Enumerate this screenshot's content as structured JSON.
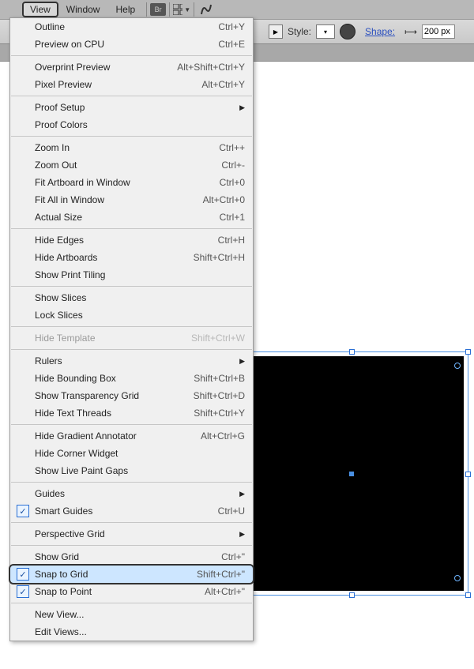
{
  "menubar": {
    "items": [
      "View",
      "Window",
      "Help"
    ]
  },
  "optbar": {
    "style_label": "Style:",
    "shape_link": "Shape:",
    "dim_value": "200 px"
  },
  "menu": {
    "sections": [
      [
        {
          "label": "Outline",
          "shortcut": "Ctrl+Y"
        },
        {
          "label": "Preview on CPU",
          "shortcut": "Ctrl+E"
        }
      ],
      [
        {
          "label": "Overprint Preview",
          "shortcut": "Alt+Shift+Ctrl+Y"
        },
        {
          "label": "Pixel Preview",
          "shortcut": "Alt+Ctrl+Y"
        }
      ],
      [
        {
          "label": "Proof Setup",
          "submenu": true
        },
        {
          "label": "Proof Colors"
        }
      ],
      [
        {
          "label": "Zoom In",
          "shortcut": "Ctrl++"
        },
        {
          "label": "Zoom Out",
          "shortcut": "Ctrl+-"
        },
        {
          "label": "Fit Artboard in Window",
          "shortcut": "Ctrl+0"
        },
        {
          "label": "Fit All in Window",
          "shortcut": "Alt+Ctrl+0"
        },
        {
          "label": "Actual Size",
          "shortcut": "Ctrl+1"
        }
      ],
      [
        {
          "label": "Hide Edges",
          "shortcut": "Ctrl+H"
        },
        {
          "label": "Hide Artboards",
          "shortcut": "Shift+Ctrl+H"
        },
        {
          "label": "Show Print Tiling"
        }
      ],
      [
        {
          "label": "Show Slices"
        },
        {
          "label": "Lock Slices"
        }
      ],
      [
        {
          "label": "Hide Template",
          "shortcut": "Shift+Ctrl+W",
          "disabled": true
        }
      ],
      [
        {
          "label": "Rulers",
          "submenu": true
        },
        {
          "label": "Hide Bounding Box",
          "shortcut": "Shift+Ctrl+B"
        },
        {
          "label": "Show Transparency Grid",
          "shortcut": "Shift+Ctrl+D"
        },
        {
          "label": "Hide Text Threads",
          "shortcut": "Shift+Ctrl+Y"
        }
      ],
      [
        {
          "label": "Hide Gradient Annotator",
          "shortcut": "Alt+Ctrl+G"
        },
        {
          "label": "Hide Corner Widget"
        },
        {
          "label": "Show Live Paint Gaps"
        }
      ],
      [
        {
          "label": "Guides",
          "submenu": true
        },
        {
          "label": "Smart Guides",
          "shortcut": "Ctrl+U",
          "checked": true
        }
      ],
      [
        {
          "label": "Perspective Grid",
          "submenu": true
        }
      ],
      [
        {
          "label": "Show Grid",
          "shortcut": "Ctrl+\""
        },
        {
          "label": "Snap to Grid",
          "shortcut": "Shift+Ctrl+\"",
          "checked": true,
          "highlight": true
        },
        {
          "label": "Snap to Point",
          "shortcut": "Alt+Ctrl+\"",
          "checked": true
        }
      ],
      [
        {
          "label": "New View..."
        },
        {
          "label": "Edit Views..."
        }
      ]
    ]
  }
}
